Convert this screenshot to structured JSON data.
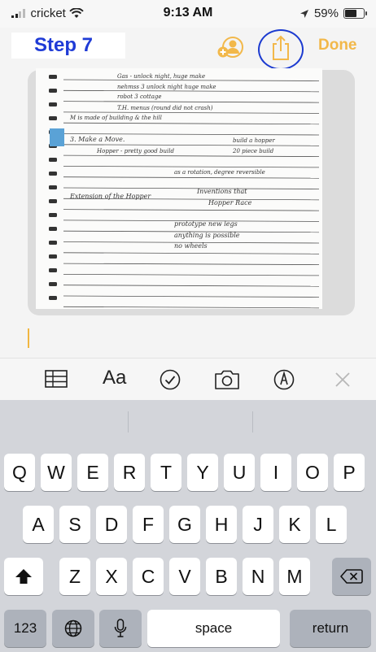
{
  "status_bar": {
    "carrier": "cricket",
    "time": "9:13 AM",
    "battery_pct": "59%"
  },
  "nav": {
    "step_label": "Step 7",
    "done_label": "Done",
    "accent": "#f2b84a",
    "highlight": "#1c3bd0"
  },
  "note": {
    "lines": [
      "Gas - unlock night, huge make",
      "nehmss 3 unlock night huge make",
      "robot 3 cottage",
      "T.H. menus (round did not crash)",
      "M is made of building & the hill",
      "3. Make a Move.",
      "Hopper - pretty good build",
      "build a hopper",
      "20 piece build",
      "as a rotation, degree reversible",
      "Extension of the Hopper",
      "Inventions that",
      "Hopper Race",
      "prototype new legs",
      "anything is possible",
      "no wheels"
    ]
  },
  "format_toolbar": {
    "text_style_label": "Aa"
  },
  "keyboard": {
    "row1": [
      "Q",
      "W",
      "E",
      "R",
      "T",
      "Y",
      "U",
      "I",
      "O",
      "P"
    ],
    "row2": [
      "A",
      "S",
      "D",
      "F",
      "G",
      "H",
      "J",
      "K",
      "L"
    ],
    "row3": [
      "Z",
      "X",
      "C",
      "V",
      "B",
      "N",
      "M"
    ],
    "numbers_label": "123",
    "space_label": "space",
    "return_label": "return"
  }
}
